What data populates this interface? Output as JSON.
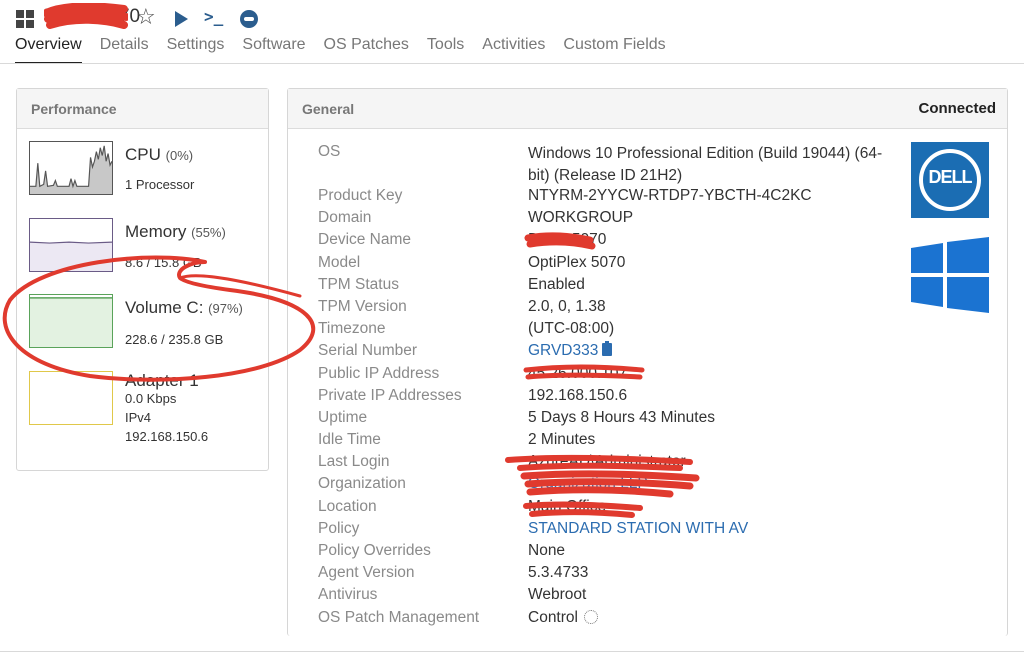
{
  "header": {
    "device_name": "DELL-5070",
    "icons": [
      "windows-icon",
      "star-icon",
      "play-icon",
      "terminal-icon",
      "remote-control-icon"
    ]
  },
  "tabs": [
    {
      "label": "Overview",
      "active": true
    },
    {
      "label": "Details"
    },
    {
      "label": "Settings"
    },
    {
      "label": "Software"
    },
    {
      "label": "OS Patches"
    },
    {
      "label": "Tools"
    },
    {
      "label": "Activities"
    },
    {
      "label": "Custom Fields"
    }
  ],
  "performance": {
    "title": "Performance",
    "cpu": {
      "title": "CPU",
      "percent": "(0%)",
      "detail": "1 Processor"
    },
    "memory": {
      "title": "Memory",
      "percent": "(55%)",
      "detail": "8.6 / 15.8 GB"
    },
    "volume": {
      "title": "Volume C:",
      "percent": "(97%)",
      "detail": "228.6 / 235.8 GB"
    },
    "adapter": {
      "title": "Adapter 1",
      "speed": "0.0 Kbps",
      "protocol": "IPv4",
      "ip": "192.168.150.6"
    }
  },
  "general": {
    "title": "General",
    "status": "Connected",
    "rows": [
      {
        "label": "OS",
        "value": "Windows 10 Professional Edition (Build 19044) (64-bit) (Release ID 21H2)"
      },
      {
        "label": "Product Key",
        "value": "NTYRM-2YYCW-RTDP7-YBCTH-4C2KC"
      },
      {
        "label": "Domain",
        "value": "WORKGROUP"
      },
      {
        "label": "Device Name",
        "value": "DELL-5070"
      },
      {
        "label": "Model",
        "value": "OptiPlex 5070"
      },
      {
        "label": "TPM Status",
        "value": "Enabled"
      },
      {
        "label": "TPM Version",
        "value": "2.0, 0, 1.38"
      },
      {
        "label": "Timezone",
        "value": "(UTC-08:00)"
      },
      {
        "label": "Serial Number",
        "value": "GRVD333"
      },
      {
        "label": "Public IP Address",
        "value": "45.26.000.107"
      },
      {
        "label": "Private IP Addresses",
        "value": "192.168.150.6"
      },
      {
        "label": "Uptime",
        "value": "5 Days 8 Hours 43 Minutes"
      },
      {
        "label": "Idle Time",
        "value": "2 Minutes"
      },
      {
        "label": "Last Login",
        "value": "AzureAD\\Administrator"
      },
      {
        "label": "Organization",
        "value": "Organization LLP"
      },
      {
        "label": "Location",
        "value": "Main Office"
      },
      {
        "label": "Policy",
        "value": "STANDARD STATION WITH AV"
      },
      {
        "label": "Policy Overrides",
        "value": "None"
      },
      {
        "label": "Agent Version",
        "value": "5.3.4733"
      },
      {
        "label": "Antivirus",
        "value": "Webroot"
      },
      {
        "label": "OS Patch Management",
        "value": "Control"
      }
    ]
  },
  "logos": {
    "dell": "DELL"
  },
  "colors": {
    "link": "#2b6cb0",
    "accent": "#2b5d8e",
    "dell_blue": "#1b6db3",
    "windows_blue": "#1b73d1",
    "annotation_red": "#e03a2e"
  }
}
